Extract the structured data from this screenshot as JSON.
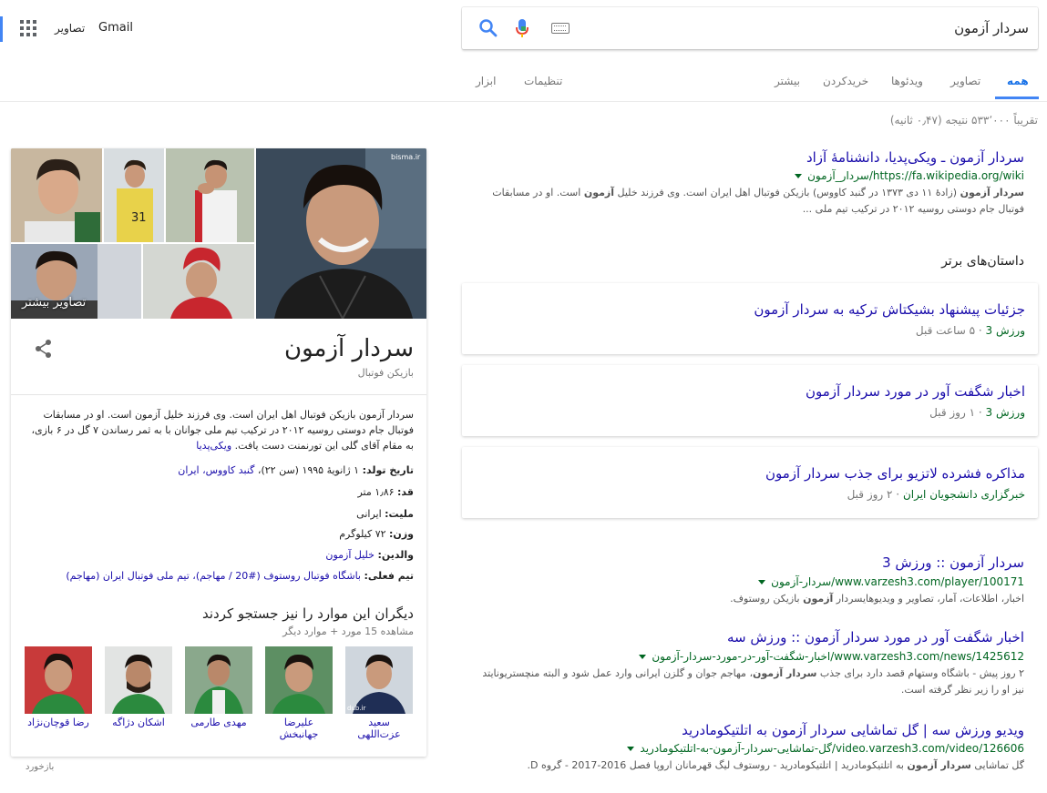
{
  "header": {
    "gmail": "Gmail",
    "images": "تصاویر",
    "search_query": "سردار آزمون"
  },
  "tabs": [
    {
      "label": "همه",
      "active": true
    },
    {
      "label": "تصاویر"
    },
    {
      "label": "ویدئوها"
    },
    {
      "label": "خریدکردن"
    },
    {
      "label": "بیشتر"
    },
    {
      "label": "تنظیمات"
    },
    {
      "label": "ابزار"
    }
  ],
  "result_stats": "تقریباً ۵۳۳٬۰۰۰ نتیجه (۰٫۴۷ ثانیه)",
  "results": [
    {
      "title": "سردار آزمون ـ ویکی‌پدیا، دانشنامهٔ آزاد",
      "url": "https://fa.wikipedia.org/wiki/سردار_آزمون",
      "snippet_1": "سردار آزمون",
      "snippet_2": " (زادهٔ ۱۱ دی ۱۳۷۳ در گنبد کاووس) بازیکن فوتبال اهل ایران است. وی فرزند خلیل ",
      "snippet_3": "آزمون",
      "snippet_4": " است. او در مسابقات فوتبال جام دوستی روسیه ۲۰۱۲ در ترکیب تیم ملی ..."
    },
    {
      "title": "سردار آزمون :: ورزش 3",
      "url": "www.varzesh3.com/player/100171/سردار-آزمون",
      "snippet_1": "اخبار، اطلاعات، آمار، تصاویر و ویدیوهایسردار ",
      "snippet_2": "آزمون",
      "snippet_3": " بازیکن روستوف."
    },
    {
      "title": "اخبار شگفت آور در مورد سردار آزمون :: ورزش سه",
      "url": "www.varzesh3.com/news/1425612/اخبار-شگفت-آور-در-مورد-سردار-آزمون",
      "snippet_1": "۲ روز پیش - باشگاه وستهام قصد دارد برای جذب ",
      "snippet_2": "سردار آزمون",
      "snippet_3": "، مهاجم جوان و گلزن ایرانی وارد عمل شود و البته منچستریونایتد نیز او را زیر نظر گرفته است."
    },
    {
      "title": "ویدیو ورزش سه | گل تماشایی سردار آزمون به اتلتیکومادرید",
      "url": "video.varzesh3.com/video/126606/گل-تماشایی-سردار-آزمون-به-اتلتیکومادرید",
      "snippet_1": "گل تماشایی ",
      "snippet_2": "سردار آزمون",
      "snippet_3": " به اتلتیکومادرید | اتلتیکومادرید - روستوف لیگ قهرمانان اروپا فصل 2016-2017 - گروه D."
    }
  ],
  "top_stories": {
    "heading": "داستان‌های برتر",
    "items": [
      {
        "title": "جزئیات پیشنهاد بشیکتاش ترکیه به سردار آزمون",
        "source": "ورزش 3",
        "time": "۵ ساعت قبل"
      },
      {
        "title": "اخبار شگفت آور در مورد سردار آزمون",
        "source": "ورزش 3",
        "time": "۱ روز قبل"
      },
      {
        "title": "مذاکره فشرده لاتزیو برای جذب سردار آزمون",
        "source": "خبرگزاری دانشجویان ایران",
        "time": "۲ روز قبل"
      }
    ]
  },
  "knowledge_panel": {
    "more_images": "تصاویر بیشتر",
    "title": "سردار آزمون",
    "subtitle": "بازیکن فوتبال",
    "description": "سردار آزمون بازیکن فوتبال اهل ایران است. وی فرزند خلیل آزمون است. او در مسابقات فوتبال جام دوستی روسیه ۲۰۱۲ در ترکیب تیم ملی جوانان با به ثمر رساندن ۷ گل در ۶ بازی، به مقام آقای گلی این تورنمنت دست یافت.",
    "wiki_link": "ویکی‌پدیا",
    "facts": [
      {
        "label": "تاریخ تولد:",
        "value": "۱ ژانویهٔ ۱۹۹۵ (سن ۲۲)، ",
        "link": "گنبد کاووس، ایران"
      },
      {
        "label": "قد:",
        "value": "۱٫۸۶ متر",
        "link": ""
      },
      {
        "label": "ملیت:",
        "value": "ایرانی",
        "link": ""
      },
      {
        "label": "وزن:",
        "value": "۷۲ کیلوگرم",
        "link": ""
      },
      {
        "label": "والدین:",
        "value": "",
        "link": "خلیل آزمون"
      },
      {
        "label": "تیم فعلی:",
        "value": "",
        "link": "باشگاه فوتبال روستوف (#20 / مهاجم)، تیم ملی فوتبال ایران (مهاجم)"
      }
    ],
    "pasf_heading": "دیگران این موارد را نیز جستجو کردند",
    "pasf_count": "مشاهده 15 مورد + موارد دیگر",
    "people": [
      {
        "name": "سعید عزت‌اللهی"
      },
      {
        "name": "علیرضا جهانبخش"
      },
      {
        "name": "مهدی طارمی"
      },
      {
        "name": "اشکان دژاگه"
      },
      {
        "name": "رضا قوچان‌نژاد"
      }
    ],
    "photo_watermark": "bisma.ir",
    "person1_watermark": "dub.ir"
  },
  "feedback": "بازخورد",
  "colors": {
    "link": "#1a0dab",
    "url_green": "#006621",
    "accent_blue": "#4285f4"
  }
}
